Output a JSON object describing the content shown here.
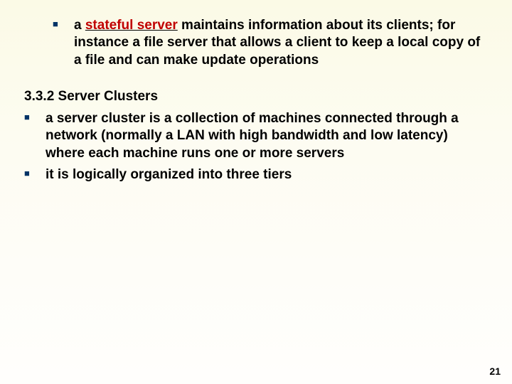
{
  "top_bullet": {
    "highlight": "stateful server",
    "prefix": "a ",
    "rest": " maintains information about its clients; for instance a file server that allows a client to keep a local copy of a file and can make update operations"
  },
  "section": {
    "number": "3.3.2",
    "title": "Server Clusters"
  },
  "section_bullets": [
    "a server cluster is a collection of machines connected through a network (normally a LAN with high bandwidth and low latency) where each machine runs one or more servers",
    "it is logically organized into three tiers"
  ],
  "page_number": "21"
}
